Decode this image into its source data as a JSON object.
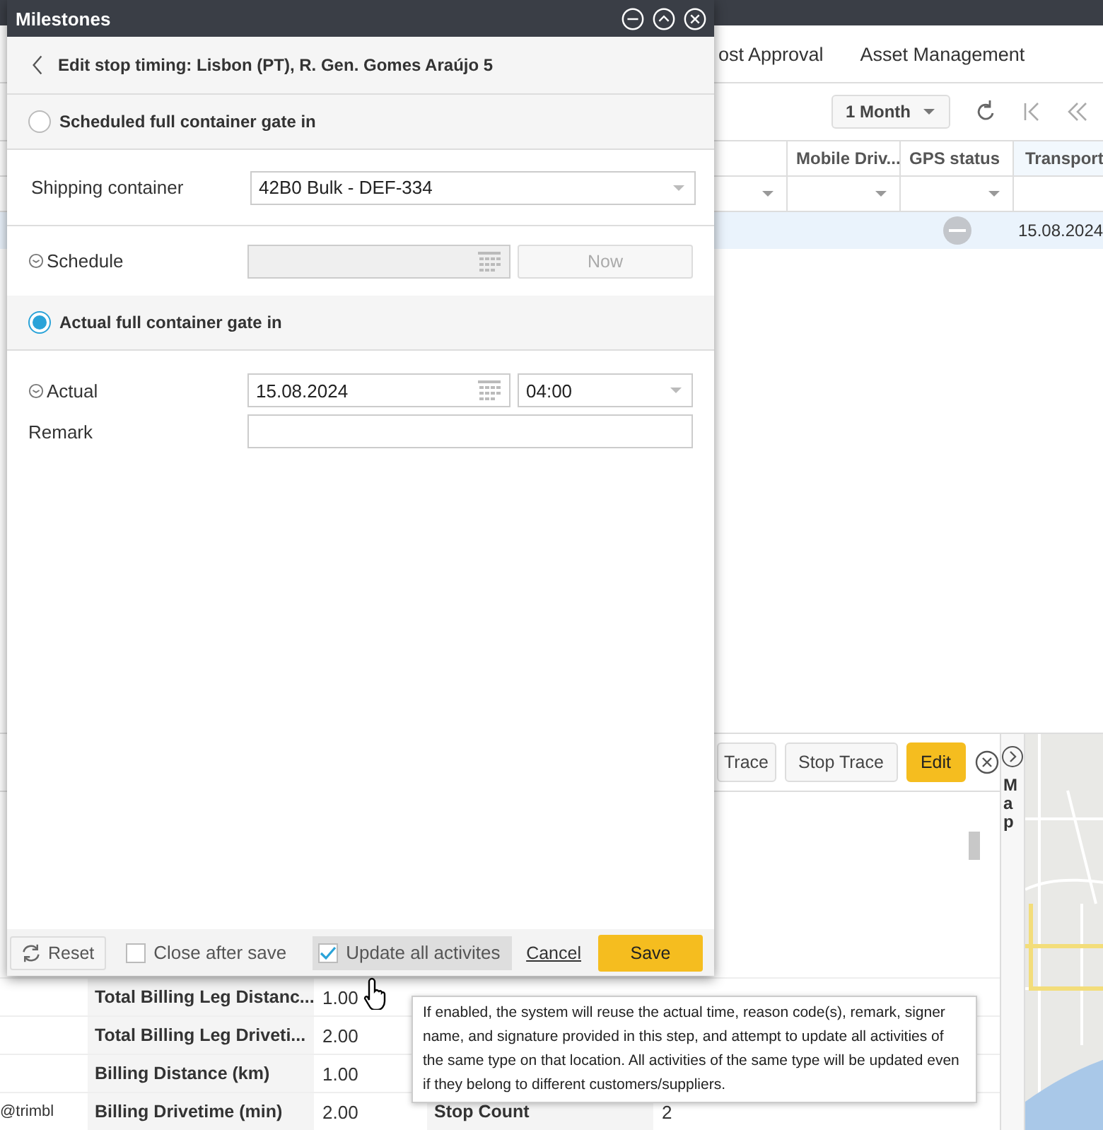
{
  "nav": {
    "items": [
      "ost Approval",
      "Asset Management"
    ]
  },
  "toolbar": {
    "period": "1 Month"
  },
  "grid": {
    "columns": [
      {
        "label": "Mobile Driv...",
        "sorted": false
      },
      {
        "label": "GPS status",
        "sorted": false
      },
      {
        "label": "Transport",
        "sorted": true
      }
    ],
    "rows": [
      {
        "selected": true,
        "transport": "15.08.2024"
      }
    ]
  },
  "detail_panel": {
    "buttons": [
      {
        "label": "Trace",
        "kind": "default"
      },
      {
        "label": "Stop Trace",
        "kind": "default"
      },
      {
        "label": "Edit",
        "kind": "primary"
      }
    ],
    "map_tab": "Map",
    "side_text": "@trimbl",
    "rows": [
      {
        "label": "Total Billing Leg Distanc...",
        "value": "1.00"
      },
      {
        "label": "Total Billing Leg Driveti...",
        "value": "2.00"
      },
      {
        "label": "Billing Distance (km)",
        "value": "1.00"
      },
      {
        "label": "Billing Drivetime (min)",
        "value": "2.00",
        "right_label": "Stop Count",
        "right_value": "2"
      }
    ]
  },
  "dialog": {
    "title": "Milestones",
    "heading": "Edit stop timing: Lisbon (PT), R. Gen. Gomes Araújo 5",
    "sections": [
      {
        "label": "Scheduled full container gate in",
        "selected": false,
        "fields": [
          {
            "kind": "select",
            "label": "Shipping container",
            "value": "42B0 Bulk - DEF-334"
          },
          {
            "kind": "date-now",
            "label": "Schedule",
            "disabled": true,
            "button": "Now"
          }
        ]
      },
      {
        "label": "Actual full container gate in",
        "selected": true,
        "fields": [
          {
            "kind": "date-time",
            "label": "Actual",
            "date": "15.08.2024",
            "time": "04:00"
          },
          {
            "kind": "text",
            "label": "Remark"
          }
        ]
      }
    ],
    "footer": {
      "reset": "Reset",
      "checkboxes": [
        {
          "label": "Close after save",
          "checked": false,
          "hovered": false
        },
        {
          "label": "Update all activites",
          "checked": true,
          "hovered": true
        }
      ],
      "cancel": "Cancel",
      "save": "Save"
    }
  },
  "tooltip": "If enabled, the system will reuse the actual time, reason code(s), remark, signer name, and signature provided in this step, and attempt to update all activities of the same type on that location. All activities of the same type will be updated even if they belong to different customers/suppliers."
}
